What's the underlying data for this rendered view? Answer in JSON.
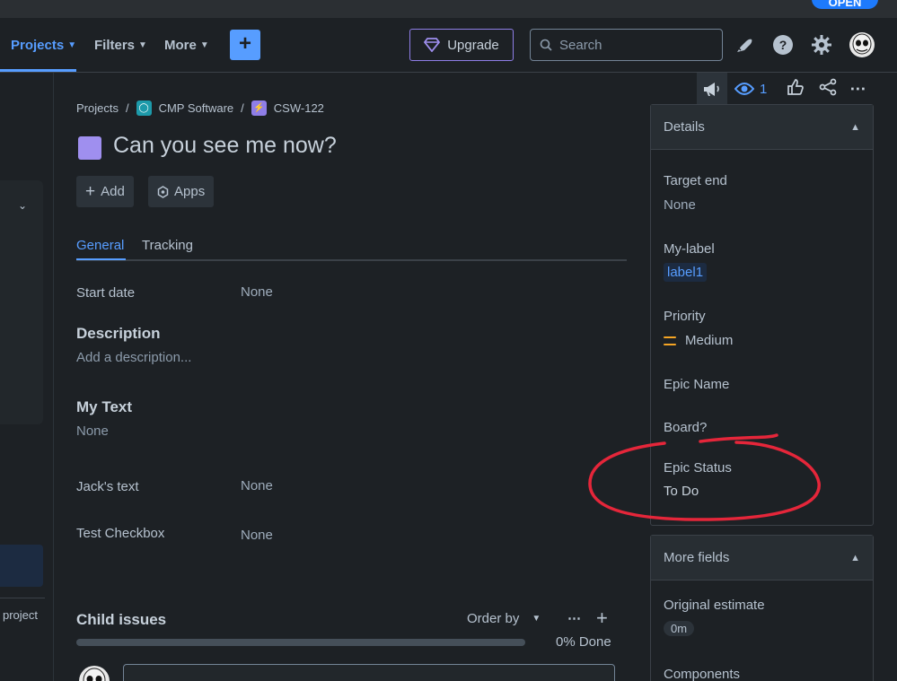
{
  "topbar": {
    "pill_label": "OPEN"
  },
  "nav": {
    "projects": "Projects",
    "filters": "Filters",
    "more": "More",
    "upgrade": "Upgrade",
    "search_placeholder": "Search"
  },
  "left_sidebar": {
    "project_text": "project"
  },
  "breadcrumb": {
    "root": "Projects",
    "sep": "/",
    "project": "CMP Software",
    "issue_key": "CSW-122"
  },
  "issue": {
    "title": "Can you see me now?",
    "add_label": "Add",
    "apps_label": "Apps"
  },
  "tabs": {
    "general": "General",
    "tracking": "Tracking"
  },
  "fields": {
    "start_date_label": "Start date",
    "start_date_value": "None",
    "description_heading": "Description",
    "description_placeholder": "Add a description...",
    "my_text_heading": "My Text",
    "my_text_value": "None",
    "jacks_text_label": "Jack's text",
    "jacks_text_value": "None",
    "test_checkbox_label": "Test Checkbox",
    "test_checkbox_value": "None"
  },
  "child_issues": {
    "title": "Child issues",
    "order_by": "Order by",
    "done_text": "0% Done",
    "progress": 0
  },
  "actions": {
    "watch_count": "1"
  },
  "details": {
    "title": "Details",
    "target_end_label": "Target end",
    "target_end_value": "None",
    "my_label_label": "My-label",
    "my_label_value": "label1",
    "priority_label": "Priority",
    "priority_value": "Medium",
    "epic_name_label": "Epic Name",
    "board_label": "Board?",
    "epic_status_label": "Epic Status",
    "epic_status_value": "To Do"
  },
  "more_fields": {
    "title": "More fields",
    "original_estimate_label": "Original estimate",
    "original_estimate_value": "0m",
    "components_label": "Components"
  },
  "colors": {
    "accent": "#579dff",
    "background": "#1d2125",
    "annotation": "#e5263a",
    "issue_type": "#9f8fef",
    "priority_medium": "#f5a524"
  }
}
